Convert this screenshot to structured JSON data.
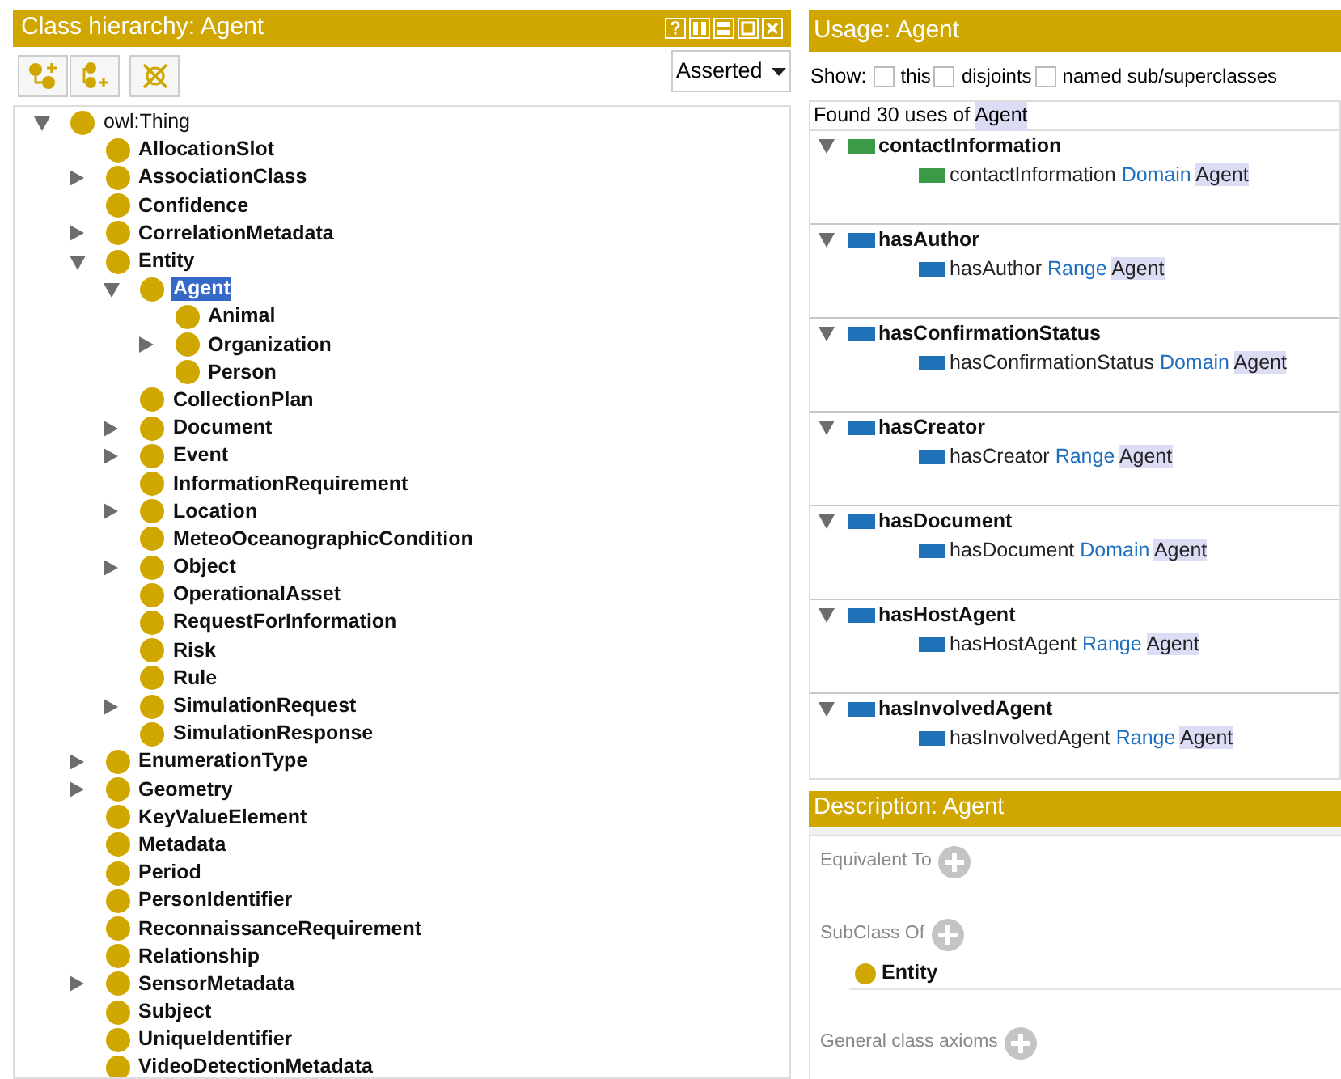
{
  "class_hierarchy": {
    "title": "Class hierarchy: Agent",
    "view_mode": "Asserted",
    "tree": [
      {
        "label": "owl:Thing",
        "kind": "expanded",
        "bold": false,
        "selected": false,
        "children": [
          {
            "label": "AllocationSlot",
            "kind": "leaf",
            "bold": true,
            "selected": false
          },
          {
            "label": "AssociationClass",
            "kind": "collapsed",
            "bold": true,
            "selected": false
          },
          {
            "label": "Confidence",
            "kind": "leaf",
            "bold": true,
            "selected": false
          },
          {
            "label": "CorrelationMetadata",
            "kind": "collapsed",
            "bold": true,
            "selected": false
          },
          {
            "label": "Entity",
            "kind": "expanded",
            "bold": true,
            "selected": false,
            "children": [
              {
                "label": "Agent",
                "kind": "expanded",
                "bold": true,
                "selected": true,
                "children": [
                  {
                    "label": "Animal",
                    "kind": "leaf",
                    "bold": true,
                    "selected": false
                  },
                  {
                    "label": "Organization",
                    "kind": "collapsed",
                    "bold": true,
                    "selected": false
                  },
                  {
                    "label": "Person",
                    "kind": "leaf",
                    "bold": true,
                    "selected": false
                  }
                ]
              },
              {
                "label": "CollectionPlan",
                "kind": "leaf",
                "bold": true,
                "selected": false
              },
              {
                "label": "Document",
                "kind": "collapsed",
                "bold": true,
                "selected": false
              },
              {
                "label": "Event",
                "kind": "collapsed",
                "bold": true,
                "selected": false
              },
              {
                "label": "InformationRequirement",
                "kind": "leaf",
                "bold": true,
                "selected": false
              },
              {
                "label": "Location",
                "kind": "collapsed",
                "bold": true,
                "selected": false
              },
              {
                "label": "MeteoOceanographicCondition",
                "kind": "leaf",
                "bold": true,
                "selected": false
              },
              {
                "label": "Object",
                "kind": "collapsed",
                "bold": true,
                "selected": false
              },
              {
                "label": "OperationalAsset",
                "kind": "leaf",
                "bold": true,
                "selected": false
              },
              {
                "label": "RequestForInformation",
                "kind": "leaf",
                "bold": true,
                "selected": false
              },
              {
                "label": "Risk",
                "kind": "leaf",
                "bold": true,
                "selected": false
              },
              {
                "label": "Rule",
                "kind": "leaf",
                "bold": true,
                "selected": false
              },
              {
                "label": "SimulationRequest",
                "kind": "collapsed",
                "bold": true,
                "selected": false
              },
              {
                "label": "SimulationResponse",
                "kind": "leaf",
                "bold": true,
                "selected": false
              }
            ]
          },
          {
            "label": "EnumerationType",
            "kind": "collapsed",
            "bold": true,
            "selected": false
          },
          {
            "label": "Geometry",
            "kind": "collapsed",
            "bold": true,
            "selected": false
          },
          {
            "label": "KeyValueElement",
            "kind": "leaf",
            "bold": true,
            "selected": false
          },
          {
            "label": "Metadata",
            "kind": "leaf",
            "bold": true,
            "selected": false
          },
          {
            "label": "Period",
            "kind": "leaf",
            "bold": true,
            "selected": false
          },
          {
            "label": "PersonIdentifier",
            "kind": "leaf",
            "bold": true,
            "selected": false
          },
          {
            "label": "ReconnaissanceRequirement",
            "kind": "leaf",
            "bold": true,
            "selected": false
          },
          {
            "label": "Relationship",
            "kind": "leaf",
            "bold": true,
            "selected": false
          },
          {
            "label": "SensorMetadata",
            "kind": "collapsed",
            "bold": true,
            "selected": false
          },
          {
            "label": "Subject",
            "kind": "leaf",
            "bold": true,
            "selected": false
          },
          {
            "label": "UniqueIdentifier",
            "kind": "leaf",
            "bold": true,
            "selected": false
          },
          {
            "label": "VideoDetectionMetadata",
            "kind": "leaf",
            "bold": true,
            "selected": false
          }
        ]
      }
    ]
  },
  "usage": {
    "title": "Usage: Agent",
    "show_label": "Show:",
    "filters": [
      {
        "label": "this",
        "checked": false
      },
      {
        "label": "disjoints",
        "checked": false
      },
      {
        "label": "named sub/superclasses",
        "checked": false
      }
    ],
    "found_prefix": "Found 30 uses of",
    "found_entity": "Agent",
    "groups": [
      {
        "property": "contactInformation",
        "color": "#3a9a48",
        "axiom": {
          "subject": "contactInformation",
          "keyword": "Domain",
          "object": "Agent"
        }
      },
      {
        "property": "hasAuthor",
        "color": "#1f72b8",
        "axiom": {
          "subject": "hasAuthor",
          "keyword": "Range",
          "object": "Agent"
        }
      },
      {
        "property": "hasConfirmationStatus",
        "color": "#1f72b8",
        "axiom": {
          "subject": "hasConfirmationStatus",
          "keyword": "Domain",
          "object": "Agent"
        }
      },
      {
        "property": "hasCreator",
        "color": "#1f72b8",
        "axiom": {
          "subject": "hasCreator",
          "keyword": "Range",
          "object": "Agent"
        }
      },
      {
        "property": "hasDocument",
        "color": "#1f72b8",
        "axiom": {
          "subject": "hasDocument",
          "keyword": "Domain",
          "object": "Agent"
        }
      },
      {
        "property": "hasHostAgent",
        "color": "#1f72b8",
        "axiom": {
          "subject": "hasHostAgent",
          "keyword": "Range",
          "object": "Agent"
        }
      },
      {
        "property": "hasInvolvedAgent",
        "color": "#1f72b8",
        "axiom": {
          "subject": "hasInvolvedAgent",
          "keyword": "Range",
          "object": "Agent"
        }
      }
    ]
  },
  "description": {
    "title": "Description: Agent",
    "sections": [
      {
        "label": "Equivalent To"
      },
      {
        "label": "SubClass Of",
        "items": [
          "Entity"
        ]
      },
      {
        "label": "General class axioms"
      }
    ]
  }
}
